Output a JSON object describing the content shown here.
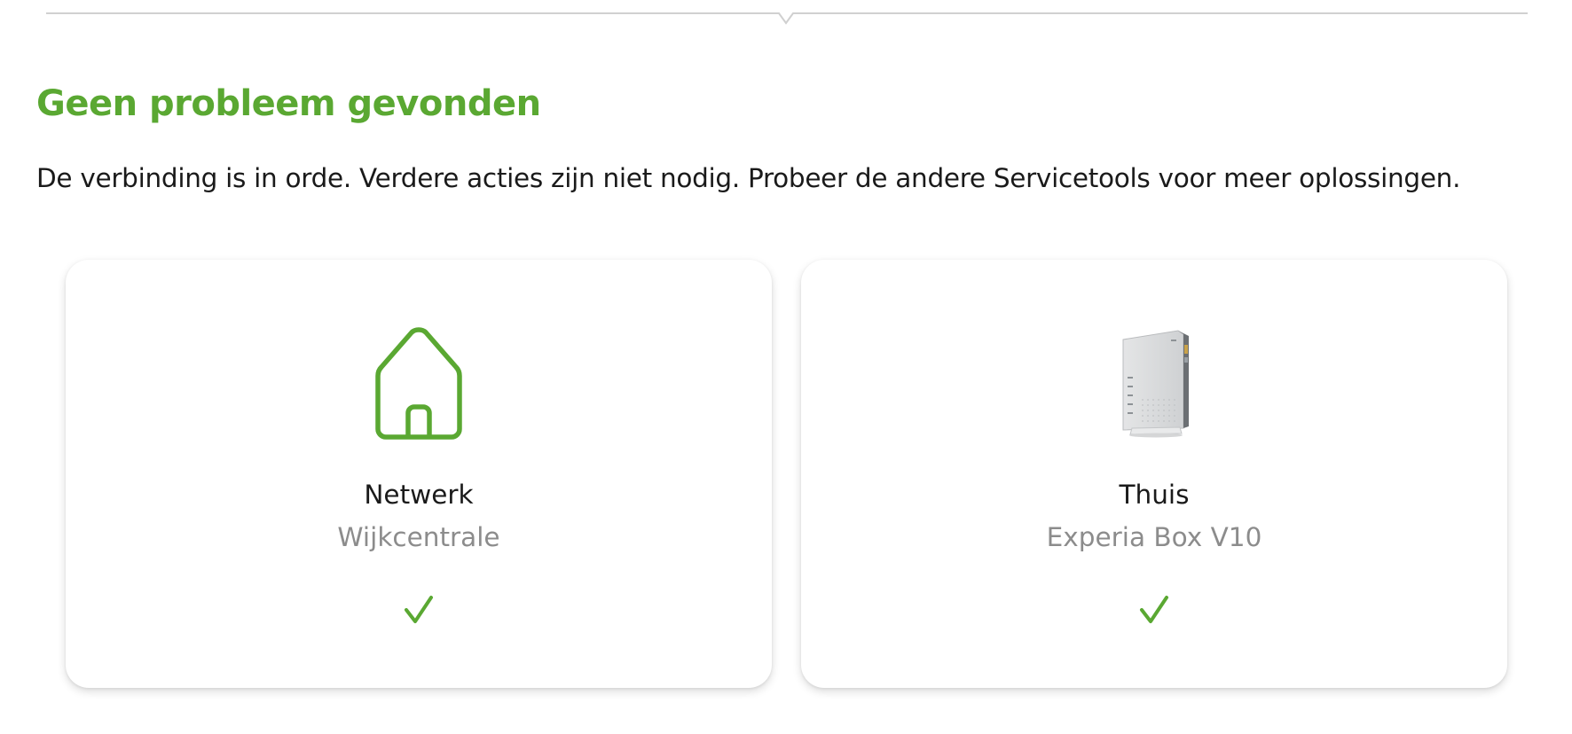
{
  "status": {
    "title": "Geen probleem gevonden",
    "message": "De verbinding is in orde. Verdere acties zijn niet nodig. Probeer de andere Servicetools voor meer oplossingen."
  },
  "cards": [
    {
      "title": "Netwerk",
      "subtitle": "Wijkcentrale",
      "icon": "house-icon",
      "status_icon": "checkmark-icon"
    },
    {
      "title": "Thuis",
      "subtitle": "Experia Box V10",
      "icon": "modem-router-image",
      "status_icon": "checkmark-icon"
    }
  ],
  "colors": {
    "accent_green": "#5aa832",
    "text": "#1a1a1a",
    "muted_text": "#8c8c8c",
    "divider": "#d0d0d0"
  }
}
